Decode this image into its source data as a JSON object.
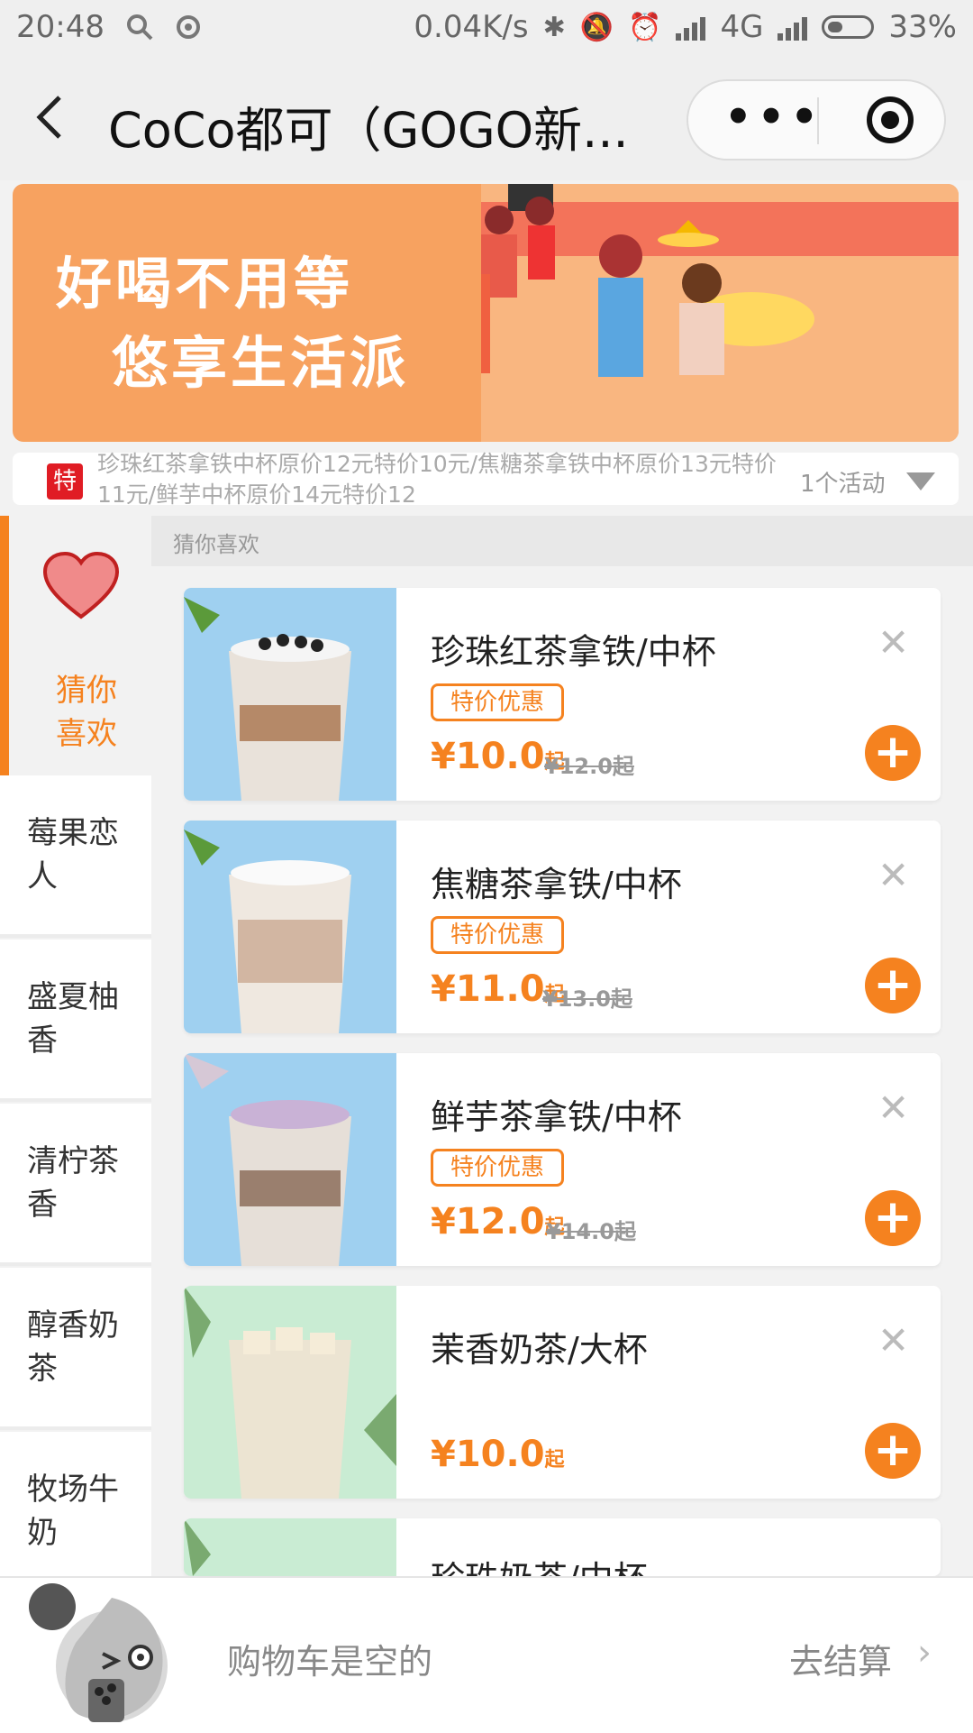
{
  "status_bar": {
    "time": "20:48",
    "net_speed": "0.04K/s",
    "network": "4G",
    "battery": "33%"
  },
  "nav": {
    "title": "CoCo都可（GOGO新..."
  },
  "banner": {
    "line1": "好喝不用等",
    "line2": "悠享生活派"
  },
  "promo": {
    "tag": "特",
    "text": "珍珠红茶拿铁中杯原价12元特价10元/焦糖茶拿铁中杯原价13元特价11元/鲜芋中杯原价14元特价12",
    "count": "1个活动"
  },
  "sidebar": {
    "active": "猜你喜欢",
    "items": [
      "莓果恋人",
      "盛夏柚香",
      "清柠茶香",
      "醇香奶茶",
      "牧场牛奶"
    ]
  },
  "section_title": "猜你喜欢",
  "products": [
    {
      "name": "珍珠红茶拿铁/中杯",
      "badge": "特价优惠",
      "price": "¥10.0",
      "suffix": "起",
      "original": "¥12.0起"
    },
    {
      "name": "焦糖茶拿铁/中杯",
      "badge": "特价优惠",
      "price": "¥11.0",
      "suffix": "起",
      "original": "¥13.0起"
    },
    {
      "name": "鲜芋茶拿铁/中杯",
      "badge": "特价优惠",
      "price": "¥12.0",
      "suffix": "起",
      "original": "¥14.0起"
    },
    {
      "name": "茉香奶茶/大杯",
      "badge": "",
      "price": "¥10.0",
      "suffix": "起",
      "original": ""
    },
    {
      "name": "珍珠奶茶/中杯",
      "badge": "",
      "price": "",
      "suffix": "",
      "original": ""
    }
  ],
  "cart": {
    "empty_text": "购物车是空的",
    "checkout": "去结算"
  },
  "colors": {
    "accent": "#f5821f",
    "promo_tag": "#e01c24",
    "banner": "#f7a260"
  }
}
